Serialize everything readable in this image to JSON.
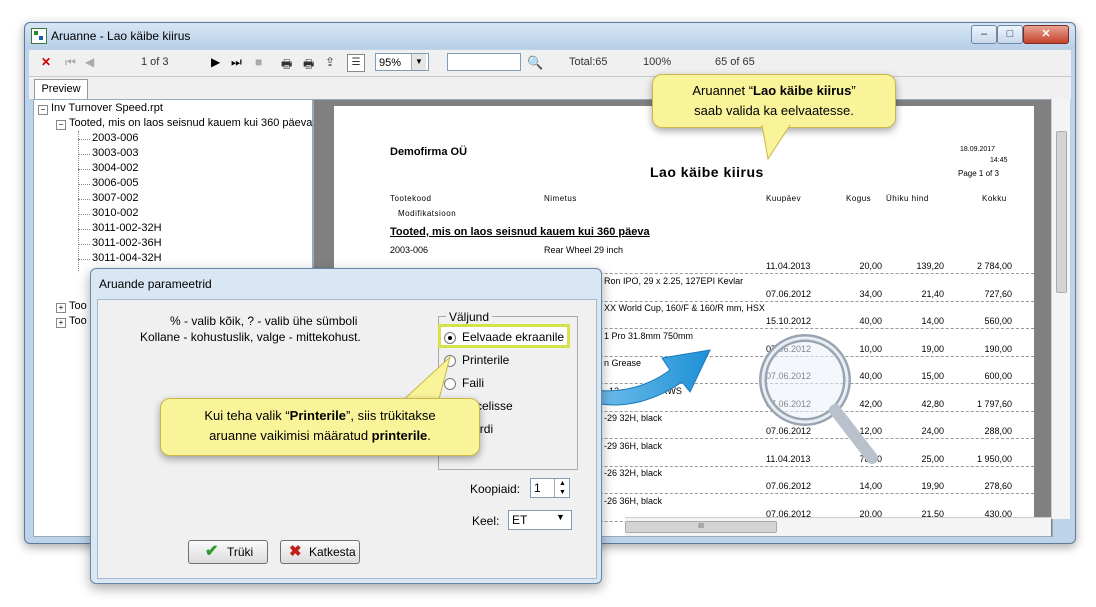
{
  "window": {
    "title": "Aruanne - Lao käibe kiirus",
    "min_glyph": "–",
    "max_glyph": "□",
    "close_glyph": "✕"
  },
  "toolbar": {
    "page_indicator": "1 of 3",
    "zoom": "95%",
    "total": "Total:65",
    "percent": "100%",
    "records": "65 of 65"
  },
  "tabs": {
    "preview": "Preview"
  },
  "tree": {
    "root": "Inv Turnover Speed.rpt",
    "group": "Tooted, mis on laos seisnud kauem kui 360 päeva",
    "items": [
      "2003-006",
      "3003-003",
      "3004-002",
      "3006-005",
      "3007-002",
      "3010-002",
      "3011-002-32H",
      "3011-002-36H",
      "3011-004-32H"
    ],
    "collapsed1": "Too",
    "collapsed2": "Too"
  },
  "report": {
    "company": "Demofirma OÜ",
    "title": "Lao käibe kiirus",
    "date": "18.09.2017",
    "time": "14:45",
    "page": "Page 1 of 3",
    "columns": {
      "code": "Tootekood",
      "name": "Nimetus",
      "date": "Kuupäev",
      "qty": "Kogus",
      "unit": "Ühiku hind",
      "total": "Kokku",
      "mod": "Modifikatsioon"
    },
    "group_title": "Tooted, mis on laos seisnud kauem kui 360 päeva",
    "first_code": "2003-006",
    "first_name": "Rear Wheel 29 inch",
    "rows": [
      {
        "name": "",
        "date": "11.04.2013",
        "qty": "20,00",
        "unit": "139,20",
        "total": "2 784,00"
      },
      {
        "name": "Ron IPO, 29 x 2.25, 127EPI Kevlar",
        "date": "07.06.2012",
        "qty": "34,00",
        "unit": "21,40",
        "total": "727,60"
      },
      {
        "name": "XX World Cup, 160/F & 160/R mm, HSX",
        "date": "15.10.2012",
        "qty": "40,00",
        "unit": "14,00",
        "total": "560,00"
      },
      {
        "name": "1 Pro 31.8mm 750mm",
        "date": "07.06.2012",
        "qty": "10,00",
        "unit": "19,00",
        "total": "190,00"
      },
      {
        "name": "n Grease",
        "date": "07.06.2012",
        "qty": "40,00",
        "unit": "15,00",
        "total": "600,00"
      },
      {
        "name": ", 12 x 142mm RWS",
        "date": "07.06.2012",
        "qty": "42,00",
        "unit": "42,80",
        "total": "1 797,60"
      },
      {
        "name": "-29 32H, black",
        "date": "07.06.2012",
        "qty": "12,00",
        "unit": "24,00",
        "total": "288,00"
      },
      {
        "name": "-29 36H, black",
        "date": "11.04.2013",
        "qty": "78,00",
        "unit": "25,00",
        "total": "1 950,00"
      },
      {
        "name": "-26 32H, black",
        "date": "07.06.2012",
        "qty": "14,00",
        "unit": "19,90",
        "total": "278,60"
      },
      {
        "name": "-26 36H, black",
        "date": "07.06.2012",
        "qty": "20,00",
        "unit": "21,50",
        "total": "430,00"
      }
    ],
    "hscroll_grip": "III"
  },
  "dialog": {
    "title": "Aruande parameetrid",
    "hint1": "% - valib kõik, ? - valib ühe sümboli",
    "hint2": "Kollane - kohustuslik, valge - mittekohust.",
    "group": "Väljund",
    "options": [
      "Eelvaade ekraanile",
      "Printerile",
      "Faili",
      "Excelisse",
      "Wordi"
    ],
    "copies_label": "Koopiaid:",
    "copies": "1",
    "lang_label": "Keel:",
    "lang": "ET",
    "print_button": "Trüki",
    "cancel_button": "Katkesta"
  },
  "callouts": {
    "top_pre": "Aruannet “",
    "top_bold": "Lao käibe kiirus",
    "top_post": "”",
    "top_line2": "saab valida ka eelvaatesse.",
    "bottom_pre": "Kui teha valik “",
    "bottom_bold": "Printerile",
    "bottom_post": "”, siis trükitakse",
    "bottom_line2_pre": "aruanne vaikimisi määratud ",
    "bottom_line2_bold": "printerile",
    "bottom_line2_post": "."
  },
  "colors": {
    "callout": "#f9f39a",
    "highlight": "#d6e24a",
    "arrow": "#29a3e6"
  }
}
